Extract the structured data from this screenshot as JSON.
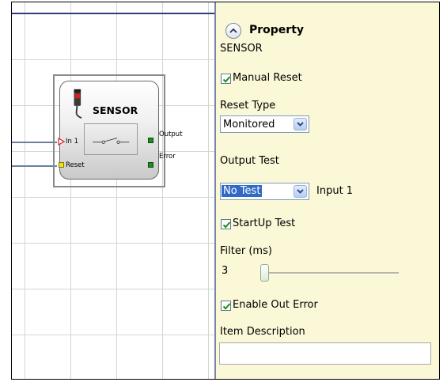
{
  "canvas": {
    "block": {
      "title": "SENSOR",
      "inputs": [
        "In 1",
        "Reset"
      ],
      "outputs": [
        "Output",
        "Error"
      ]
    }
  },
  "property_panel": {
    "header": "Property",
    "component_name": "SENSOR",
    "manual_reset": {
      "label": "Manual Reset",
      "checked": true
    },
    "reset_type": {
      "label": "Reset Type",
      "value": "Monitored"
    },
    "output_test": {
      "label": "Output Test",
      "value": "No Test",
      "input_label": "Input 1"
    },
    "startup_test": {
      "label": "StartUp Test",
      "checked": true
    },
    "filter": {
      "label": "Filter (ms)",
      "value": "3"
    },
    "enable_out_error": {
      "label": "Enable Out Error",
      "checked": true
    },
    "item_description": {
      "label": "Item Description",
      "value": ""
    }
  },
  "colors": {
    "panel_bg": "#fbf8d8",
    "selection": "#316ac5",
    "port_green": "#1e8c1e",
    "port_yellow": "#f0e020",
    "input_arrow": "#e02020"
  }
}
